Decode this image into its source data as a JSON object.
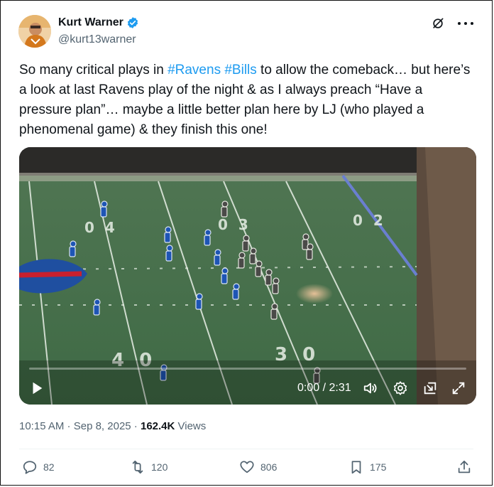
{
  "author": {
    "name": "Kurt Warner",
    "handle": "@kurt13warner",
    "verified": true
  },
  "tweet": {
    "text_before": "So many critical plays in ",
    "hashtag1": "#Ravens",
    "space": " ",
    "hashtag2": "#Bills",
    "text_after": " to allow the comeback… but here’s a look at last Ravens play of the night & as I always preach “Have a pressure plan”… maybe a little better plan here by LJ (who played a phenomenal game) & they finish this one!"
  },
  "video": {
    "time": "0:00 / 2:31",
    "progress": 0.0
  },
  "meta": {
    "time": "10:15 AM",
    "separator": " · ",
    "date": "Sep 8, 2025",
    "separator2": " · ",
    "views_count": "162.4K",
    "views_label": " Views"
  },
  "actions": {
    "replies": "82",
    "reposts": "120",
    "likes": "806",
    "bookmarks": "175"
  },
  "colors": {
    "link": "#1d9bf0",
    "verified": "#1d9bf0",
    "muted": "#536471"
  }
}
